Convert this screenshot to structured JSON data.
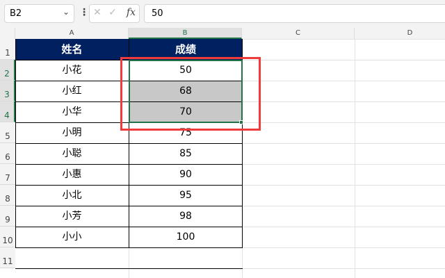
{
  "formula_bar": {
    "name_box": "B2",
    "cancel": "✕",
    "confirm": "✓",
    "fx": "fx",
    "value": "50"
  },
  "columns": [
    "A",
    "B",
    "C",
    "D"
  ],
  "rows": [
    "1",
    "2",
    "3",
    "4",
    "5",
    "6",
    "7",
    "8",
    "9",
    "10",
    "11"
  ],
  "table": {
    "headers": [
      "姓名",
      "成绩"
    ],
    "data": [
      [
        "小花",
        "50"
      ],
      [
        "小红",
        "68"
      ],
      [
        "小华",
        "70"
      ],
      [
        "小明",
        "75"
      ],
      [
        "小聪",
        "85"
      ],
      [
        "小惠",
        "90"
      ],
      [
        "小北",
        "95"
      ],
      [
        "小芳",
        "98"
      ],
      [
        "小小",
        "100"
      ]
    ]
  },
  "colors": {
    "header_bg": "#002060",
    "selection": "#217346",
    "highlight": "#ef3b3b",
    "filled": "#c8c8c8"
  }
}
